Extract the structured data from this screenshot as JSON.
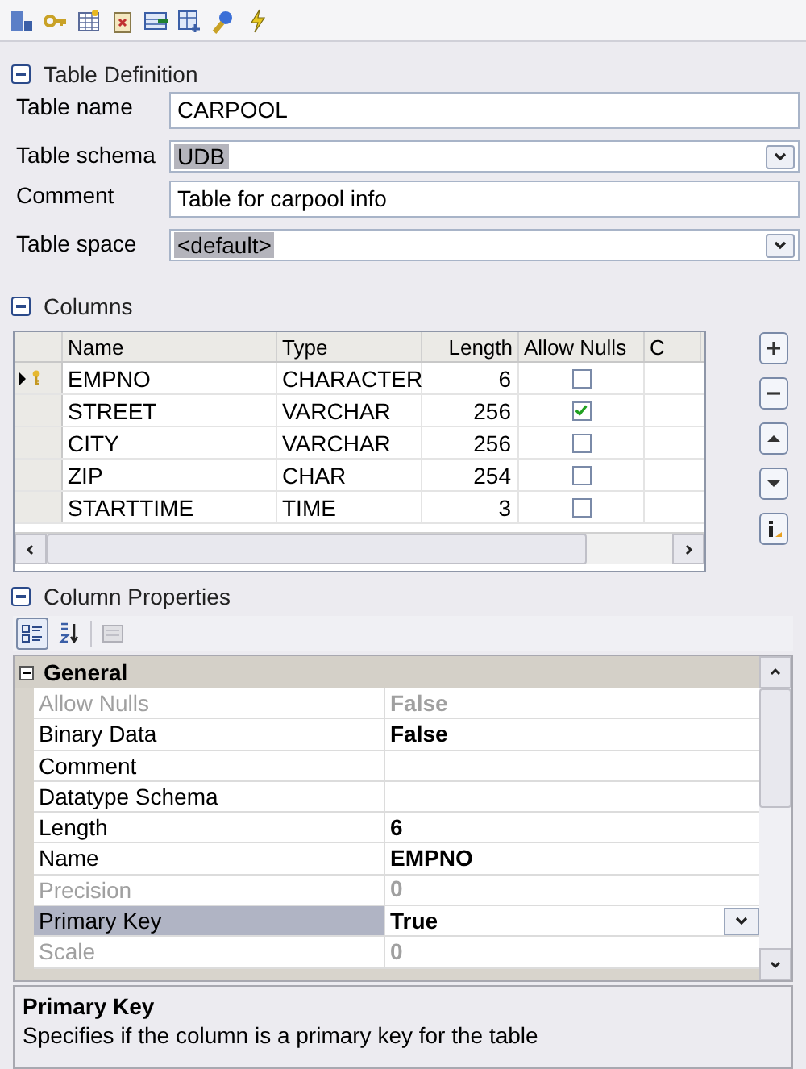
{
  "table_definition": {
    "title": "Table Definition",
    "expanded": true,
    "fields": [
      {
        "label": "Table name",
        "value": "CARPOOL",
        "kind": "text",
        "highlighted": false
      },
      {
        "label": "Table schema",
        "value": "UDB",
        "kind": "dropdown",
        "highlighted": true
      },
      {
        "label": "Comment",
        "value": "Table for carpool info",
        "kind": "text",
        "highlighted": false
      },
      {
        "label": "Table space",
        "value": "<default>",
        "kind": "dropdown",
        "highlighted": true
      }
    ]
  },
  "columns": {
    "title": "Columns",
    "expanded": true,
    "headers": [
      "Name",
      "Type",
      "Length",
      "Allow Nulls",
      "C"
    ],
    "rows": [
      {
        "name": "EMPNO",
        "type": "CHARACTER",
        "length": "6",
        "allow_nulls": false,
        "selected": true,
        "primary_key": true
      },
      {
        "name": "STREET",
        "type": "VARCHAR",
        "length": "256",
        "allow_nulls": true,
        "selected": false,
        "primary_key": false
      },
      {
        "name": "CITY",
        "type": "VARCHAR",
        "length": "256",
        "allow_nulls": false,
        "selected": false,
        "primary_key": false
      },
      {
        "name": "ZIP",
        "type": "CHAR",
        "length": "254",
        "allow_nulls": false,
        "selected": false,
        "primary_key": false
      },
      {
        "name": "STARTTIME",
        "type": "TIME",
        "length": "3",
        "allow_nulls": false,
        "selected": false,
        "primary_key": false
      }
    ]
  },
  "column_properties": {
    "title": "Column Properties",
    "expanded": true,
    "category": {
      "title": "General",
      "expanded": true
    },
    "items": [
      {
        "name": "Allow Nulls",
        "value": "False",
        "disabled": true,
        "selected": false
      },
      {
        "name": "Binary Data",
        "value": "False",
        "disabled": false,
        "selected": false
      },
      {
        "name": "Comment",
        "disabled": false,
        "selected": false
      },
      {
        "name": "Datatype Schema",
        "disabled": false,
        "selected": false
      },
      {
        "name": "Length",
        "value": "6",
        "disabled": false,
        "selected": false
      },
      {
        "name": "Name",
        "value": "EMPNO",
        "disabled": false,
        "selected": false
      },
      {
        "name": "Precision",
        "value": "0",
        "disabled": true,
        "selected": false
      },
      {
        "name": "Primary Key",
        "value": "True",
        "disabled": false,
        "selected": true
      },
      {
        "name": "Scale",
        "value": "0",
        "disabled": true,
        "selected": false
      }
    ],
    "description": {
      "title": "Primary Key",
      "text": "Specifies if the column is a primary key for the table"
    }
  }
}
